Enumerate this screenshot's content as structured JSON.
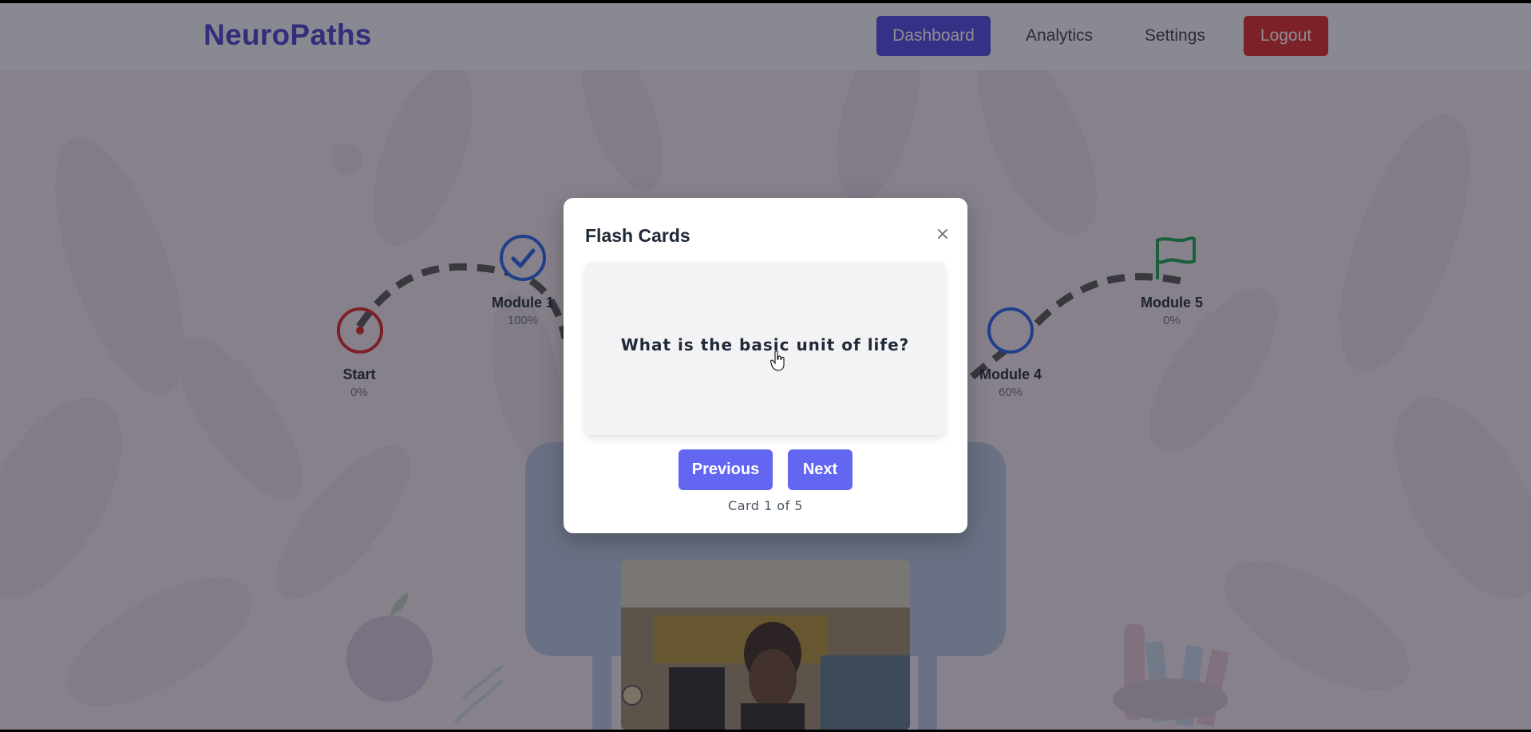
{
  "nav": {
    "brand": "NeuroPaths",
    "items": [
      {
        "label": "Dashboard",
        "active": true
      },
      {
        "label": "Analytics",
        "active": false
      },
      {
        "label": "Settings",
        "active": false
      }
    ],
    "logout": "Logout"
  },
  "roadmap": {
    "nodes": [
      {
        "name": "Start",
        "progress": "0%",
        "icon": "target-icon",
        "color": "#dc2626"
      },
      {
        "name": "Module 1",
        "progress": "100%",
        "icon": "check-circle-icon",
        "color": "#2563eb"
      },
      {
        "name": "Module 4",
        "progress": "60%",
        "icon": "circle-icon",
        "color": "#2563eb"
      },
      {
        "name": "Module 5",
        "progress": "0%",
        "icon": "flag-icon",
        "color": "#16a34a"
      }
    ]
  },
  "modal": {
    "title": "Flash Cards",
    "close": "×",
    "question": "What is the basic unit of life?",
    "previous": "Previous",
    "next": "Next",
    "counter": "Card 1 of 5"
  },
  "colors": {
    "brand": "#4b3fcf",
    "primary": "#4f46e5",
    "button": "#6366f1",
    "danger": "#dc2626"
  }
}
